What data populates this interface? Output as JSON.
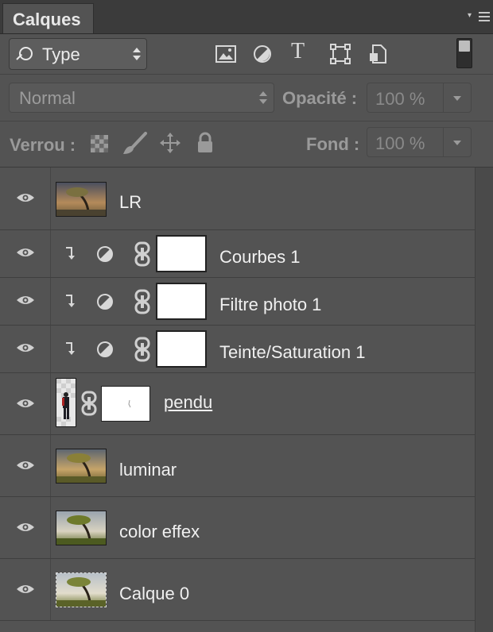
{
  "panel": {
    "tab_title": "Calques",
    "menu_icon": "panel-menu-icon"
  },
  "filter": {
    "kind_label": "Type",
    "icons": [
      "image-filter-icon",
      "adjustment-filter-icon",
      "type-filter-icon",
      "shape-filter-icon",
      "smart-object-filter-icon"
    ],
    "type_glyph": "T"
  },
  "blend": {
    "mode": "Normal",
    "opacity_label": "Opacité :",
    "opacity_value": "100 %"
  },
  "lock": {
    "label": "Verrou :",
    "fill_label": "Fond :",
    "fill_value": "100 %",
    "icons": [
      "lock-transparent-icon",
      "lock-paint-icon",
      "lock-move-icon",
      "lock-all-icon"
    ]
  },
  "layers": [
    {
      "name": "LR",
      "type": "pixel"
    },
    {
      "name": "Courbes 1",
      "type": "adjustment"
    },
    {
      "name": "Filtre photo 1",
      "type": "adjustment"
    },
    {
      "name": "Teinte/Saturation 1",
      "type": "adjustment"
    },
    {
      "name": "pendu",
      "type": "masked"
    },
    {
      "name": "luminar",
      "type": "pixel"
    },
    {
      "name": "color effex",
      "type": "pixel"
    },
    {
      "name": "Calque 0",
      "type": "pixel"
    }
  ],
  "colors": {
    "panel_bg": "#535353",
    "tab_bar": "#3b3b3b",
    "text": "#f0f0f0"
  }
}
